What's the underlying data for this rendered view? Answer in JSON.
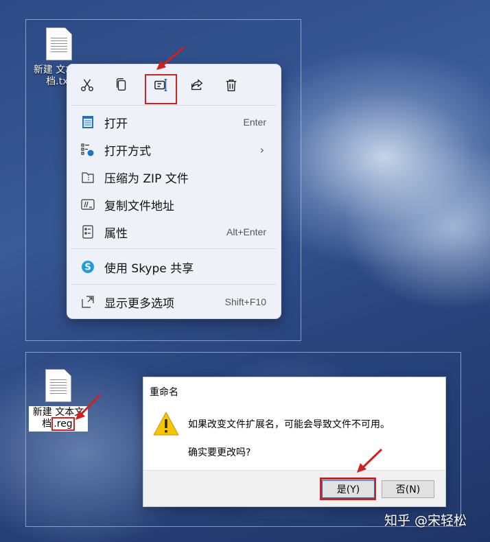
{
  "desktop_top": {
    "icon_label": "新建 文本文档.txt"
  },
  "context_menu": {
    "toolbar": [
      {
        "icon": "cut-icon",
        "label": "剪切"
      },
      {
        "icon": "copy-icon",
        "label": "复制"
      },
      {
        "icon": "rename-icon",
        "label": "重命名"
      },
      {
        "icon": "share-icon",
        "label": "共享"
      },
      {
        "icon": "delete-icon",
        "label": "删除"
      }
    ],
    "items": [
      {
        "label": "打开",
        "shortcut": "Enter",
        "icon": "notepad-icon"
      },
      {
        "label": "打开方式",
        "icon": "open-with-icon",
        "has_submenu": true
      },
      {
        "label": "压缩为 ZIP 文件",
        "icon": "zip-folder-icon"
      },
      {
        "label": "复制文件地址",
        "icon": "copy-path-icon"
      },
      {
        "label": "属性",
        "shortcut": "Alt+Enter",
        "icon": "properties-icon"
      },
      {
        "label": "使用 Skype 共享",
        "icon": "skype-icon"
      },
      {
        "label": "显示更多选项",
        "shortcut": "Shift+F10",
        "icon": "more-options-icon"
      }
    ]
  },
  "desktop_bottom": {
    "icon_label_main": "新建 文本文",
    "icon_label_prefix": "档",
    "icon_label_ext": ".reg"
  },
  "rename_dialog": {
    "title": "重命名",
    "message": "如果改变文件扩展名，可能会导致文件不可用。",
    "question": "确实要更改吗?",
    "yes_label": "是(Y)",
    "no_label": "否(N)"
  },
  "watermark": "知乎 @宋轻松",
  "colors": {
    "highlight": "#d21f1f",
    "menu_bg": "#eef1f7",
    "accent": "#0078d7"
  }
}
